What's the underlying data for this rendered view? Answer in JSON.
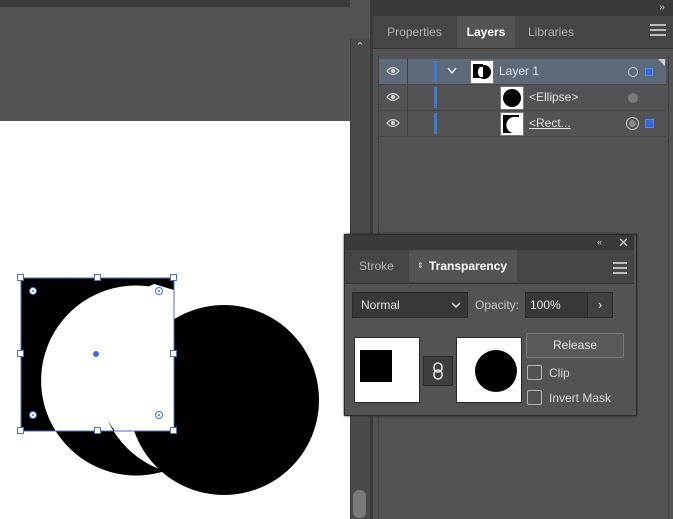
{
  "colors": {
    "ui_bg": "#535353",
    "selected_row": "#5c6a79",
    "selection_blue": "#3a7bd5",
    "artboard": "#ffffff",
    "shape_fill": "#000000"
  },
  "icons": {
    "panel_collapse": "double-chevron-right-icon",
    "scroll_up": "chevron-up-icon",
    "panel_menu": "hamburger-menu-icon",
    "visibility": "eye-icon",
    "disclosure": "chevron-down-icon",
    "link": "link-icon",
    "dropdown": "chevron-down-icon",
    "opacity_arrow": "chevron-right-icon"
  },
  "panels": {
    "layers_tabs": [
      {
        "label": "Properties",
        "active": false
      },
      {
        "label": "Layers",
        "active": true
      },
      {
        "label": "Libraries",
        "active": false
      }
    ],
    "layers": [
      {
        "name": "Layer 1",
        "level": 0,
        "selected": true,
        "expanded": true,
        "thumb": "mixed"
      },
      {
        "name": "<Ellipse>",
        "level": 1,
        "selected": false,
        "thumb": "circle"
      },
      {
        "name": "<Rect...",
        "level": 1,
        "selected": false,
        "underlined": true,
        "thumb": "rect"
      }
    ],
    "transparency": {
      "tabs": [
        {
          "label": "Stroke",
          "active": false
        },
        {
          "label": "Transparency",
          "active": true
        }
      ],
      "blend_mode": "Normal",
      "opacity_label": "Opacity:",
      "opacity_value": "100%",
      "release_label": "Release",
      "clip_label": "Clip",
      "invert_mask_label": "Invert Mask",
      "clip_checked": false,
      "invert_mask_checked": false
    }
  }
}
